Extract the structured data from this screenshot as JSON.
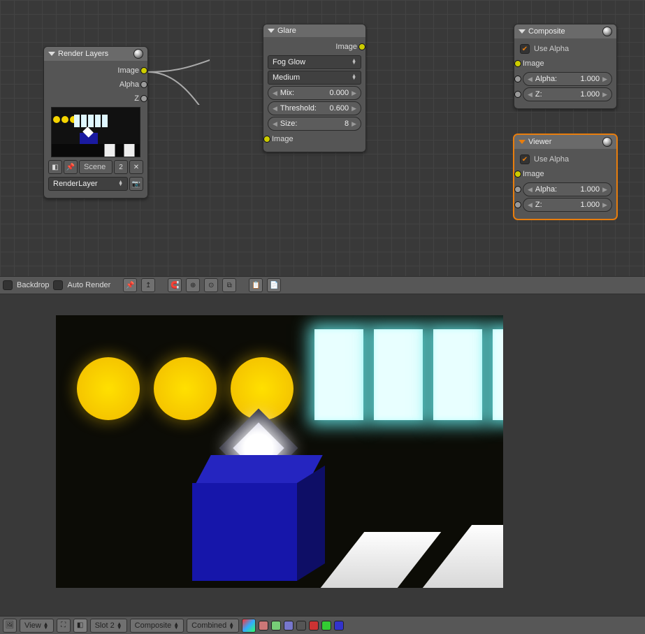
{
  "nodes": {
    "render_layers": {
      "title": "Render Layers",
      "outputs": {
        "image": "Image",
        "alpha": "Alpha",
        "z": "Z"
      },
      "scene_name": "Scene",
      "scene_users": "2",
      "layer_name": "RenderLayer"
    },
    "glare": {
      "title": "Glare",
      "out_image": "Image",
      "type": "Fog Glow",
      "quality": "Medium",
      "mix_label": "Mix:",
      "mix_value": "0.000",
      "threshold_label": "Threshold:",
      "threshold_value": "0.600",
      "size_label": "Size:",
      "size_value": "8",
      "in_image": "Image"
    },
    "composite": {
      "title": "Composite",
      "use_alpha": "Use Alpha",
      "in_image": "Image",
      "alpha_label": "Alpha:",
      "alpha_value": "1.000",
      "z_label": "Z:",
      "z_value": "1.000"
    },
    "viewer": {
      "title": "Viewer",
      "use_alpha": "Use Alpha",
      "in_image": "Image",
      "alpha_label": "Alpha:",
      "alpha_value": "1.000",
      "z_label": "Z:",
      "z_value": "1.000"
    }
  },
  "toolbar": {
    "backdrop": "Backdrop",
    "auto_render": "Auto Render"
  },
  "bottom": {
    "view": "View",
    "slot": "Slot 2",
    "pass_layer": "Composite",
    "pass": "Combined"
  },
  "chart_data": null
}
